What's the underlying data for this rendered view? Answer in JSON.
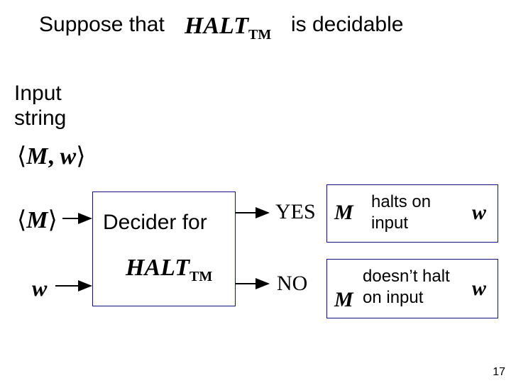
{
  "header": {
    "prefix": "Suppose that",
    "math_halt": "HALT",
    "math_sub": "TM",
    "suffix": "is decidable"
  },
  "input_label": {
    "line1": "Input",
    "line2": "string"
  },
  "encoding_M_w": {
    "open": "⟨",
    "M": "M",
    "comma": ", ",
    "w": "w",
    "close": "⟩"
  },
  "inputs": {
    "M_open": "⟨",
    "M": "M",
    "M_close": "⟩",
    "w": "w"
  },
  "decider_box": {
    "line1": "Decider for",
    "math_halt": "HALT",
    "math_sub": "TM"
  },
  "yes": {
    "label": "YES",
    "M": "M",
    "line1": "halts on",
    "line2": "input",
    "w": "w"
  },
  "no": {
    "label": "NO",
    "M": "M",
    "line1": "doesn’t halt",
    "line2": "on input",
    "w": "w"
  },
  "page_number": "17"
}
